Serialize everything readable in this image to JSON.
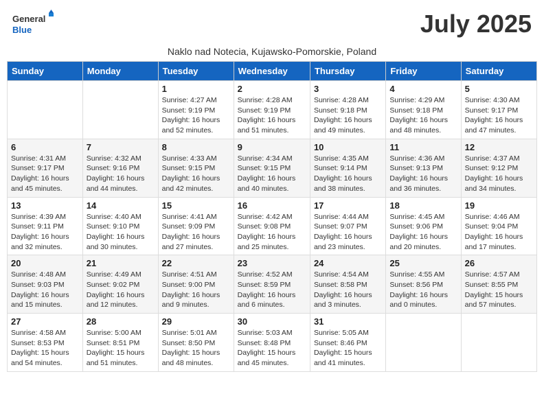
{
  "logo": {
    "general": "General",
    "blue": "Blue"
  },
  "header": {
    "month_title": "July 2025",
    "subtitle": "Naklo nad Notecia, Kujawsko-Pomorskie, Poland"
  },
  "weekdays": [
    "Sunday",
    "Monday",
    "Tuesday",
    "Wednesday",
    "Thursday",
    "Friday",
    "Saturday"
  ],
  "weeks": [
    [
      null,
      null,
      {
        "day": "1",
        "sunrise": "4:27 AM",
        "sunset": "9:19 PM",
        "daylight": "16 hours and 52 minutes."
      },
      {
        "day": "2",
        "sunrise": "4:28 AM",
        "sunset": "9:19 PM",
        "daylight": "16 hours and 51 minutes."
      },
      {
        "day": "3",
        "sunrise": "4:28 AM",
        "sunset": "9:18 PM",
        "daylight": "16 hours and 49 minutes."
      },
      {
        "day": "4",
        "sunrise": "4:29 AM",
        "sunset": "9:18 PM",
        "daylight": "16 hours and 48 minutes."
      },
      {
        "day": "5",
        "sunrise": "4:30 AM",
        "sunset": "9:17 PM",
        "daylight": "16 hours and 47 minutes."
      }
    ],
    [
      {
        "day": "6",
        "sunrise": "4:31 AM",
        "sunset": "9:17 PM",
        "daylight": "16 hours and 45 minutes."
      },
      {
        "day": "7",
        "sunrise": "4:32 AM",
        "sunset": "9:16 PM",
        "daylight": "16 hours and 44 minutes."
      },
      {
        "day": "8",
        "sunrise": "4:33 AM",
        "sunset": "9:15 PM",
        "daylight": "16 hours and 42 minutes."
      },
      {
        "day": "9",
        "sunrise": "4:34 AM",
        "sunset": "9:15 PM",
        "daylight": "16 hours and 40 minutes."
      },
      {
        "day": "10",
        "sunrise": "4:35 AM",
        "sunset": "9:14 PM",
        "daylight": "16 hours and 38 minutes."
      },
      {
        "day": "11",
        "sunrise": "4:36 AM",
        "sunset": "9:13 PM",
        "daylight": "16 hours and 36 minutes."
      },
      {
        "day": "12",
        "sunrise": "4:37 AM",
        "sunset": "9:12 PM",
        "daylight": "16 hours and 34 minutes."
      }
    ],
    [
      {
        "day": "13",
        "sunrise": "4:39 AM",
        "sunset": "9:11 PM",
        "daylight": "16 hours and 32 minutes."
      },
      {
        "day": "14",
        "sunrise": "4:40 AM",
        "sunset": "9:10 PM",
        "daylight": "16 hours and 30 minutes."
      },
      {
        "day": "15",
        "sunrise": "4:41 AM",
        "sunset": "9:09 PM",
        "daylight": "16 hours and 27 minutes."
      },
      {
        "day": "16",
        "sunrise": "4:42 AM",
        "sunset": "9:08 PM",
        "daylight": "16 hours and 25 minutes."
      },
      {
        "day": "17",
        "sunrise": "4:44 AM",
        "sunset": "9:07 PM",
        "daylight": "16 hours and 23 minutes."
      },
      {
        "day": "18",
        "sunrise": "4:45 AM",
        "sunset": "9:06 PM",
        "daylight": "16 hours and 20 minutes."
      },
      {
        "day": "19",
        "sunrise": "4:46 AM",
        "sunset": "9:04 PM",
        "daylight": "16 hours and 17 minutes."
      }
    ],
    [
      {
        "day": "20",
        "sunrise": "4:48 AM",
        "sunset": "9:03 PM",
        "daylight": "16 hours and 15 minutes."
      },
      {
        "day": "21",
        "sunrise": "4:49 AM",
        "sunset": "9:02 PM",
        "daylight": "16 hours and 12 minutes."
      },
      {
        "day": "22",
        "sunrise": "4:51 AM",
        "sunset": "9:00 PM",
        "daylight": "16 hours and 9 minutes."
      },
      {
        "day": "23",
        "sunrise": "4:52 AM",
        "sunset": "8:59 PM",
        "daylight": "16 hours and 6 minutes."
      },
      {
        "day": "24",
        "sunrise": "4:54 AM",
        "sunset": "8:58 PM",
        "daylight": "16 hours and 3 minutes."
      },
      {
        "day": "25",
        "sunrise": "4:55 AM",
        "sunset": "8:56 PM",
        "daylight": "16 hours and 0 minutes."
      },
      {
        "day": "26",
        "sunrise": "4:57 AM",
        "sunset": "8:55 PM",
        "daylight": "15 hours and 57 minutes."
      }
    ],
    [
      {
        "day": "27",
        "sunrise": "4:58 AM",
        "sunset": "8:53 PM",
        "daylight": "15 hours and 54 minutes."
      },
      {
        "day": "28",
        "sunrise": "5:00 AM",
        "sunset": "8:51 PM",
        "daylight": "15 hours and 51 minutes."
      },
      {
        "day": "29",
        "sunrise": "5:01 AM",
        "sunset": "8:50 PM",
        "daylight": "15 hours and 48 minutes."
      },
      {
        "day": "30",
        "sunrise": "5:03 AM",
        "sunset": "8:48 PM",
        "daylight": "15 hours and 45 minutes."
      },
      {
        "day": "31",
        "sunrise": "5:05 AM",
        "sunset": "8:46 PM",
        "daylight": "15 hours and 41 minutes."
      },
      null,
      null
    ]
  ]
}
